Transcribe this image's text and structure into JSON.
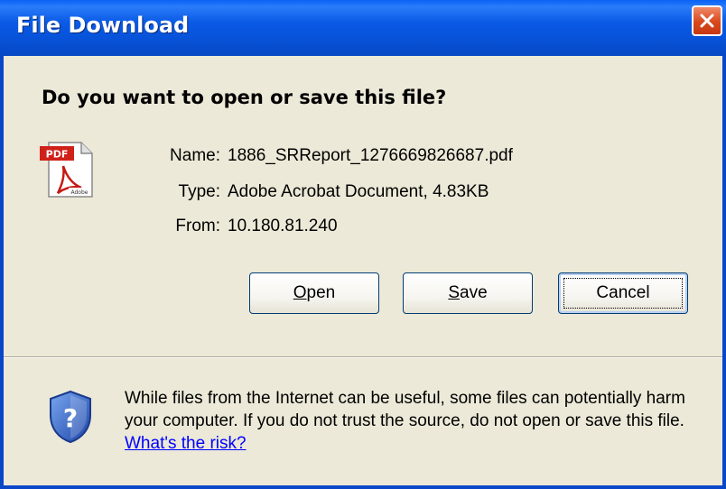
{
  "window": {
    "title": "File Download",
    "close_icon": "close-icon"
  },
  "prompt": {
    "question": "Do you want to open or save this file?"
  },
  "file": {
    "icon": "pdf-file-icon",
    "name_label": "Name:",
    "name_value": "1886_SRReport_1276669826687.pdf",
    "type_label": "Type:",
    "type_value": "Adobe Acrobat Document, 4.83KB",
    "from_label": "From:",
    "from_value": "10.180.81.240"
  },
  "buttons": {
    "open_mnemonic": "O",
    "open_rest": "pen",
    "save_mnemonic": "S",
    "save_rest": "ave",
    "cancel": "Cancel"
  },
  "warning": {
    "icon": "shield-question-icon",
    "text": "While files from the Internet can be useful, some files can potentially harm your computer. If you do not trust the source, do not open or save this file. ",
    "link": "What's the risk?"
  },
  "colors": {
    "titlebar": "#0752d8",
    "dialog_bg": "#ece9d8",
    "close_button": "#d8481c",
    "link": "#0000ff"
  }
}
